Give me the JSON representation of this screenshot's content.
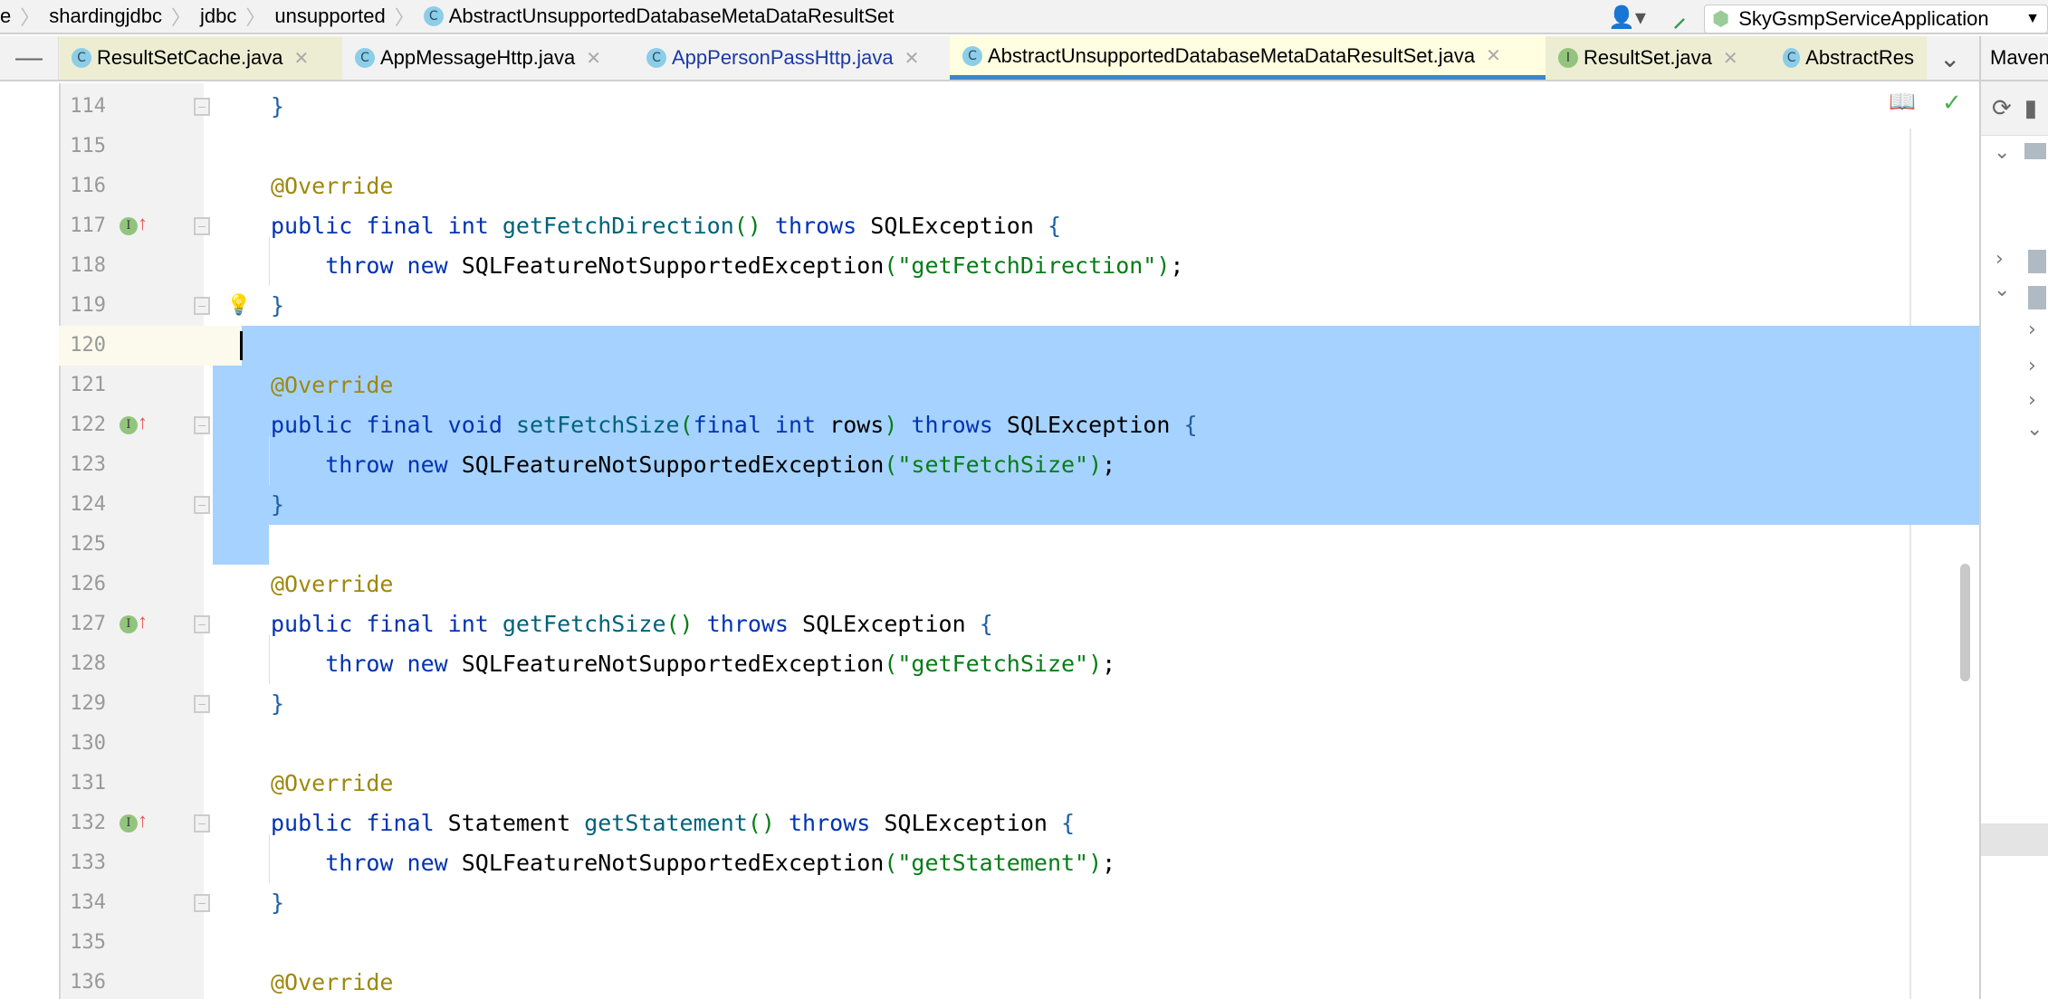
{
  "breadcrumb": [
    "e",
    "shardingjdbc",
    "jdbc",
    "unsupported",
    "AbstractUnsupportedDatabaseMetaDataResultSet"
  ],
  "run_config": "SkyGsmpServiceApplication",
  "tabs": [
    {
      "label": "ResultSetCache.java",
      "icon": "C",
      "bg": "#ededd4",
      "color": "#000"
    },
    {
      "label": "AppMessageHttp.java",
      "icon": "C",
      "bg": "#f2f2f2",
      "color": "#000"
    },
    {
      "label": "AppPersonPassHttp.java",
      "icon": "C",
      "bg": "#f2f2f2",
      "color": "#1a3aa8"
    },
    {
      "label": "AbstractUnsupportedDatabaseMetaDataResultSet.java",
      "icon": "C",
      "bg": "#fffee0",
      "color": "#000",
      "active": true
    },
    {
      "label": "ResultSet.java",
      "icon": "I",
      "bg": "#ededd4",
      "color": "#000"
    },
    {
      "label": "AbstractRes",
      "icon": "C",
      "bg": "#ededd4",
      "color": "#000"
    }
  ],
  "maven_label": "Maven",
  "colors": {
    "selection": "#a6d2ff",
    "active_tab_underline": "#4083c9",
    "gutter": "#f2f2f2",
    "current_line": "#fcfaed"
  },
  "lines": [
    {
      "n": "114",
      "t": [
        [
          "br",
          "}"
        ]
      ],
      "fold": "end"
    },
    {
      "n": "115",
      "t": []
    },
    {
      "n": "116",
      "t": [
        [
          "an",
          "@Override"
        ]
      ]
    },
    {
      "n": "117",
      "t": [
        [
          "kw",
          "public final int "
        ],
        [
          "fn",
          "getFetchDirection"
        ],
        [
          "st",
          "()"
        ],
        [
          "kw",
          " throws "
        ],
        [
          "pn",
          "SQLException "
        ],
        [
          "br",
          "{"
        ]
      ],
      "fold": "start",
      "impl": true
    },
    {
      "n": "118",
      "t": [
        [
          "pn",
          "    "
        ],
        [
          "kw",
          "throw new "
        ],
        [
          "pn",
          "SQLFeatureNotSupportedException"
        ],
        [
          "st",
          "(\"getFetchDirection\")"
        ],
        [
          "pn",
          ";"
        ]
      ]
    },
    {
      "n": "119",
      "t": [
        [
          "br",
          "}"
        ]
      ],
      "fold": "end"
    },
    {
      "n": "120",
      "t": [],
      "current": true
    },
    {
      "n": "121",
      "t": [
        [
          "an",
          "@Override"
        ]
      ]
    },
    {
      "n": "122",
      "t": [
        [
          "kw",
          "public final void "
        ],
        [
          "fn",
          "setFetchSize"
        ],
        [
          "st",
          "("
        ],
        [
          "kw",
          "final int "
        ],
        [
          "pn",
          "rows"
        ],
        [
          "st",
          ")"
        ],
        [
          "kw",
          " throws "
        ],
        [
          "pn",
          "SQLException "
        ],
        [
          "br",
          "{"
        ]
      ],
      "fold": "start",
      "impl": true
    },
    {
      "n": "123",
      "t": [
        [
          "pn",
          "    "
        ],
        [
          "kw",
          "throw new "
        ],
        [
          "pn",
          "SQLFeatureNotSupportedException"
        ],
        [
          "st",
          "(\"setFetchSize\")"
        ],
        [
          "pn",
          ";"
        ]
      ]
    },
    {
      "n": "124",
      "t": [
        [
          "br",
          "}"
        ]
      ],
      "fold": "end"
    },
    {
      "n": "125",
      "t": []
    },
    {
      "n": "126",
      "t": [
        [
          "an",
          "@Override"
        ]
      ]
    },
    {
      "n": "127",
      "t": [
        [
          "kw",
          "public final int "
        ],
        [
          "fn",
          "getFetchSize"
        ],
        [
          "st",
          "()"
        ],
        [
          "kw",
          " throws "
        ],
        [
          "pn",
          "SQLException "
        ],
        [
          "br",
          "{"
        ]
      ],
      "fold": "start",
      "impl": true
    },
    {
      "n": "128",
      "t": [
        [
          "pn",
          "    "
        ],
        [
          "kw",
          "throw new "
        ],
        [
          "pn",
          "SQLFeatureNotSupportedException"
        ],
        [
          "st",
          "(\"getFetchSize\")"
        ],
        [
          "pn",
          ";"
        ]
      ]
    },
    {
      "n": "129",
      "t": [
        [
          "br",
          "}"
        ]
      ],
      "fold": "end"
    },
    {
      "n": "130",
      "t": []
    },
    {
      "n": "131",
      "t": [
        [
          "an",
          "@Override"
        ]
      ]
    },
    {
      "n": "132",
      "t": [
        [
          "kw",
          "public final "
        ],
        [
          "pn",
          "Statement "
        ],
        [
          "fn",
          "getStatement"
        ],
        [
          "st",
          "()"
        ],
        [
          "kw",
          " throws "
        ],
        [
          "pn",
          "SQLException "
        ],
        [
          "br",
          "{"
        ]
      ],
      "fold": "start",
      "impl": true
    },
    {
      "n": "133",
      "t": [
        [
          "pn",
          "    "
        ],
        [
          "kw",
          "throw new "
        ],
        [
          "pn",
          "SQLFeatureNotSupportedException"
        ],
        [
          "st",
          "(\"getStatement\")"
        ],
        [
          "pn",
          ";"
        ]
      ]
    },
    {
      "n": "134",
      "t": [
        [
          "br",
          "}"
        ]
      ],
      "fold": "end"
    },
    {
      "n": "135",
      "t": []
    },
    {
      "n": "136",
      "t": [
        [
          "an",
          "@Override"
        ]
      ]
    }
  ]
}
